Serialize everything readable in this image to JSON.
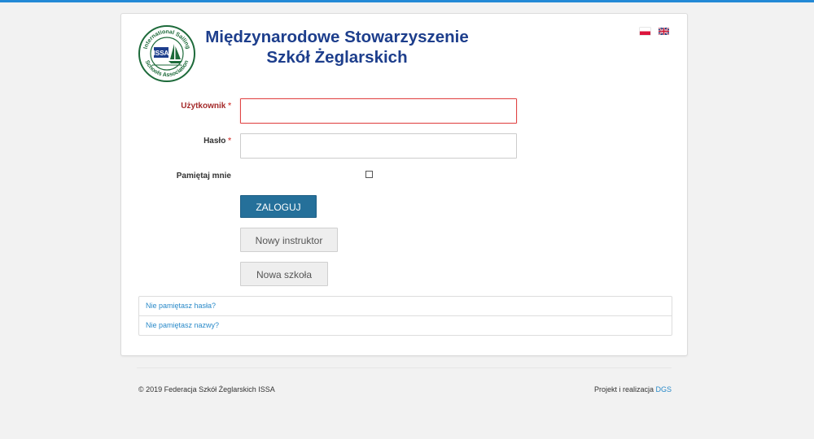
{
  "header": {
    "title_line1": "Międzynarodowe Stowarzyszenie",
    "title_line2": "Szkół Żeglarskich",
    "logo": {
      "ring_text": "International Sailing Schools Association",
      "abbr": "ISSA",
      "color": "#1d6a3a",
      "icon": "sailboat-icon"
    },
    "languages": [
      {
        "code": "pl",
        "icon": "flag-pl-icon"
      },
      {
        "code": "en",
        "icon": "flag-uk-icon"
      }
    ]
  },
  "form": {
    "username": {
      "label": "Użytkownik",
      "required_mark": "*",
      "value": "",
      "state": "error"
    },
    "password": {
      "label": "Hasło",
      "required_mark": "*",
      "value": ""
    },
    "remember": {
      "label": "Pamiętaj mnie",
      "checked": false
    },
    "login_button": "ZALOGUJ",
    "new_instructor_button": "Nowy instruktor",
    "new_school_button": "Nowa szkoła"
  },
  "links": {
    "forgot_password": "Nie pamiętasz hasła?",
    "forgot_username": "Nie pamiętasz nazwy?"
  },
  "footer": {
    "copyright": "© 2019 Federacja Szkół Żeglarskich ISSA",
    "credits_prefix": "Projekt i realizacja",
    "credits_link": "DGS"
  },
  "colors": {
    "accent": "#2389d6",
    "title": "#1d3e8c",
    "primary_button": "#25709a",
    "error": "#e04545",
    "link": "#2a8ac9"
  }
}
